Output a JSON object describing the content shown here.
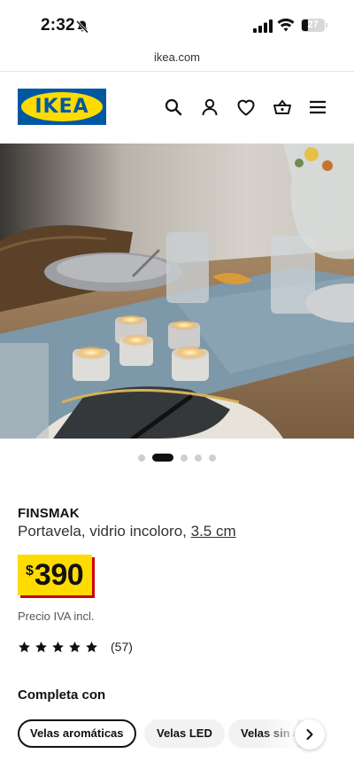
{
  "status_bar": {
    "time": "2:32",
    "battery": "27",
    "icons": [
      "bell-slash-icon",
      "signal-icon",
      "wifi-icon",
      "battery-icon"
    ]
  },
  "browser": {
    "url": "ikea.com"
  },
  "header": {
    "logo_text": "IKEA",
    "brand_colors": {
      "blue": "#0058a3",
      "yellow": "#ffdb00"
    },
    "icons": [
      "search-icon",
      "profile-icon",
      "heart-icon",
      "basket-icon",
      "menu-icon"
    ]
  },
  "gallery": {
    "image_count": 5,
    "active_index": 1
  },
  "product": {
    "name": "FINSMAK",
    "description": "Portavela, vidrio incoloro,",
    "size": "3.5 cm",
    "currency": "$",
    "price": "390",
    "price_note": "Precio IVA incl.",
    "rating_stars": 5,
    "review_count": "(57)"
  },
  "complete_with": {
    "title": "Completa con",
    "chips": [
      {
        "label": "Velas aromáticas",
        "selected": true
      },
      {
        "label": "Velas LED",
        "selected": false
      },
      {
        "label": "Velas sin a",
        "selected": false
      }
    ]
  }
}
